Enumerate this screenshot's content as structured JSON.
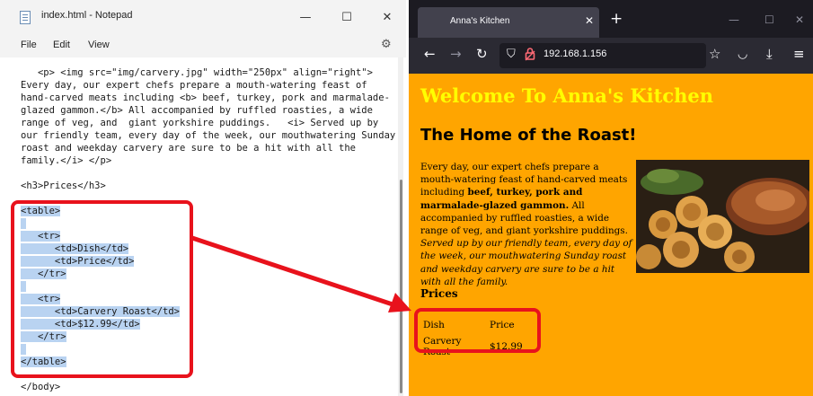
{
  "notepad": {
    "title": "index.html - Notepad",
    "menu": [
      "File",
      "Edit",
      "View"
    ],
    "window_buttons": {
      "minimize": "—",
      "maximize": "☐",
      "close": "✕"
    },
    "lines": [
      "   <p> <img src=\"img/carvery.jpg\" width=\"250px\" align=\"right\">",
      "Every day, our expert chefs prepare a mouth-watering feast of",
      "hand-carved meats including <b> beef, turkey, pork and marmalade-",
      "glazed gammon.</b> All accompanied by ruffled roasties, a wide",
      "range of veg, and  giant yorkshire puddings.   <i> Served up by",
      "our friendly team, every day of the week, our mouthwatering Sunday",
      "roast and weekday carvery are sure to be a hit with all the",
      "family.</i> </p>",
      "",
      "<h3>Prices</h3>",
      "",
      "<table>",
      "",
      "   <tr>",
      "      <td>Dish</td>",
      "      <td>Price</td>",
      "   </tr>",
      "",
      "   <tr>",
      "      <td>Carvery Roast</td>",
      "      <td>$12.99</td>",
      "   </tr>",
      "",
      "</table>",
      "",
      "</body>"
    ],
    "selected_lines": [
      11,
      12,
      13,
      14,
      15,
      16,
      17,
      18,
      19,
      20,
      21,
      22,
      23
    ]
  },
  "browser": {
    "tab_title": "Anna's Kitchen",
    "tab_close": "✕",
    "new_tab": "+",
    "window_buttons": {
      "minimize": "—",
      "maximize": "☐",
      "close": "✕"
    },
    "url": "192.168.1.156",
    "page": {
      "h1": "Welcome To Anna's Kitchen",
      "h2": "The Home of the Roast!",
      "para_plain_1": "Every day, our expert chefs prepare a mouth-watering feast of hand-carved meats including ",
      "para_bold": "beef, turkey, pork and marmalade-glazed gammon.",
      "para_plain_2": " All accompanied by ruffled roasties, a wide range of veg, and giant yorkshire puddings. ",
      "para_italic": "Served up by our friendly team, every day of the week, our mouthwatering Sunday roast and weekday carvery are sure to be a hit with all the family.",
      "h3": "Prices",
      "table": {
        "rows": [
          [
            "Dish",
            "Price"
          ],
          [
            "Carvery Roast",
            "$12.99"
          ]
        ]
      }
    }
  },
  "colors": {
    "highlight_red": "#e8121c",
    "page_background": "#ffa500",
    "heading_yellow": "#ffff00",
    "selection_blue": "#b9d3f1"
  }
}
